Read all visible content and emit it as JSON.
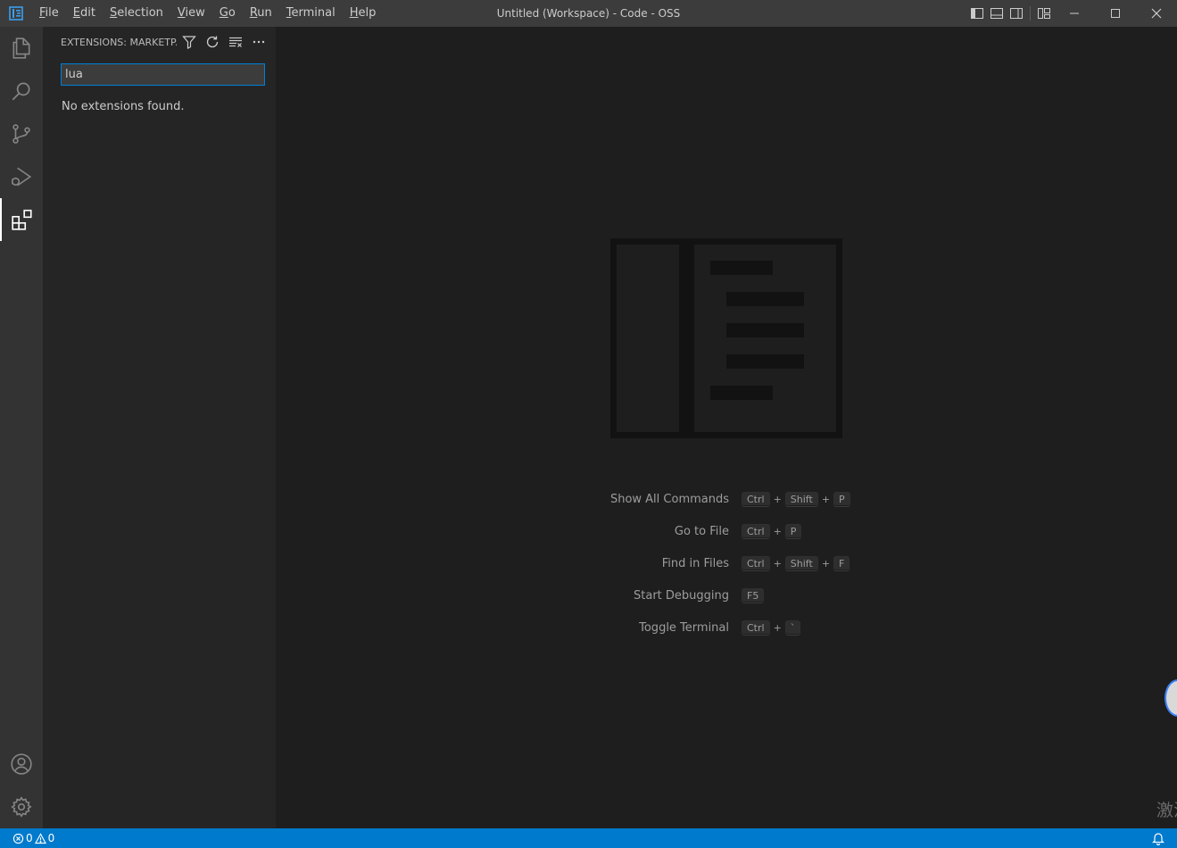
{
  "titlebar": {
    "window_title": "Untitled (Workspace) - Code - OSS",
    "menus": [
      {
        "mnemonic": "F",
        "rest": "ile"
      },
      {
        "mnemonic": "E",
        "rest": "dit"
      },
      {
        "mnemonic": "S",
        "rest": "election"
      },
      {
        "mnemonic": "V",
        "rest": "iew"
      },
      {
        "mnemonic": "G",
        "rest": "o"
      },
      {
        "mnemonic": "R",
        "rest": "un"
      },
      {
        "mnemonic": "T",
        "rest": "erminal"
      },
      {
        "mnemonic": "H",
        "rest": "elp"
      }
    ]
  },
  "activitybar": {
    "items": [
      "explorer-icon",
      "search-icon",
      "source-control-icon",
      "run-debug-icon",
      "extensions-icon"
    ],
    "bottom": [
      "accounts-icon",
      "manage-gear-icon"
    ],
    "active": "extensions-icon"
  },
  "sidebar": {
    "title": "EXTENSIONS: MARKETP...",
    "search_value": "lua",
    "empty_message": "No extensions found."
  },
  "shortcuts": [
    {
      "label": "Show All Commands",
      "keys": [
        "Ctrl",
        "Shift",
        "P"
      ]
    },
    {
      "label": "Go to File",
      "keys": [
        "Ctrl",
        "P"
      ]
    },
    {
      "label": "Find in Files",
      "keys": [
        "Ctrl",
        "Shift",
        "F"
      ]
    },
    {
      "label": "Start Debugging",
      "keys": [
        "F5"
      ]
    },
    {
      "label": "Toggle Terminal",
      "keys": [
        "Ctrl",
        "`"
      ]
    }
  ],
  "statusbar": {
    "errors": "0",
    "warnings": "0"
  },
  "corner_text": "激活"
}
